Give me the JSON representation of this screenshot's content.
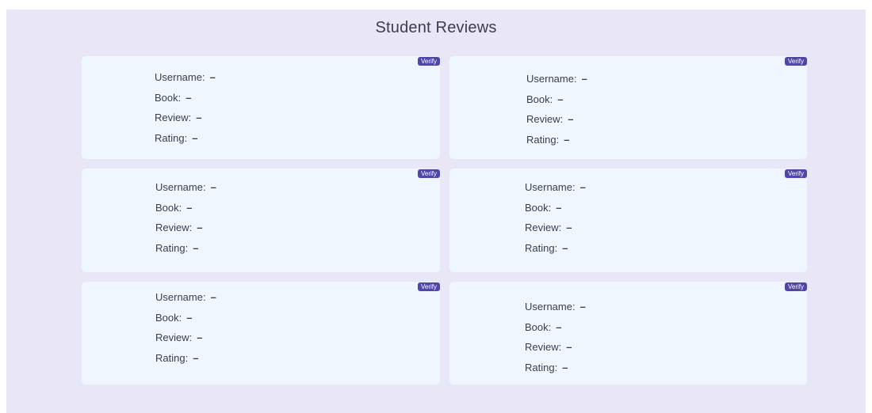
{
  "page": {
    "title": "Student Reviews"
  },
  "labels": {
    "username": "Username:",
    "book": "Book:",
    "review": "Review:",
    "rating": "Rating:",
    "verify": "Verify"
  },
  "reviews": [
    {
      "username": "–",
      "book": "–",
      "review": "–",
      "rating": "–"
    },
    {
      "username": "–",
      "book": "–",
      "review": "–",
      "rating": "–"
    },
    {
      "username": "–",
      "book": "–",
      "review": "–",
      "rating": "–"
    },
    {
      "username": "–",
      "book": "–",
      "review": "–",
      "rating": "–"
    },
    {
      "username": "–",
      "book": "–",
      "review": "–",
      "rating": "–"
    },
    {
      "username": "–",
      "book": "–",
      "review": "–",
      "rating": "–"
    }
  ],
  "colors": {
    "page_background": "#e8e6f7",
    "card_background": "#eff6ff",
    "verify_button": "#5046a8"
  }
}
